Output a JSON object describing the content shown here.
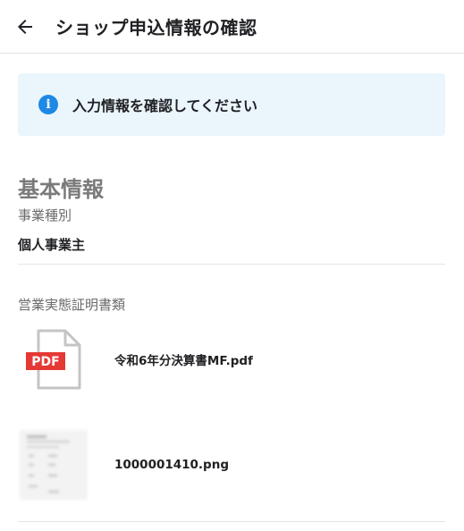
{
  "header": {
    "title": "ショップ申込情報の確認"
  },
  "banner": {
    "text": "入力情報を確認してください"
  },
  "section": {
    "title": "基本情報",
    "business_type_label": "事業種別",
    "business_type_value": "個人事業主",
    "documents_label": "営業実態証明書類"
  },
  "files": [
    {
      "name": "令和6年分決算書MF.pdf",
      "badge": "PDF",
      "icon": "pdf-file-icon"
    },
    {
      "name": "1000001410.png",
      "icon": "image-thumbnail"
    }
  ],
  "colors": {
    "accent": "#1e88e5",
    "banner_bg": "#eaf5fc",
    "pdf_red": "#e53935"
  }
}
